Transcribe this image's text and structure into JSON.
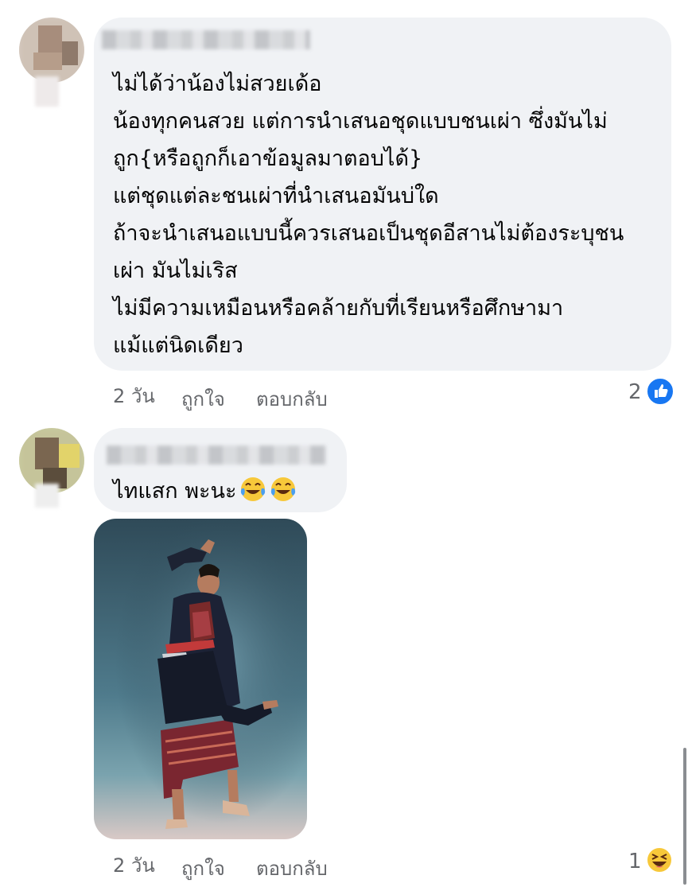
{
  "comments": [
    {
      "lines": [
        "ไม่ได้ว่าน้องไม่สวยเด้อ",
        "น้องทุกคนสวย แต่การนำเสนอชุดแบบชนเผ่า ซึ่งมันไม่",
        "ถูก{หรือถูกก็เอาข้อมูลมาตอบได้}",
        "แต่ชุดแต่ละชนเผ่าที่นำเสนอมันบ่ใด",
        "ถ้าจะนำเสนอแบบนี้ควรเสนอเป็นชุดอีสานไม่ต้องระบุชน",
        "เผ่า มันไม่เริส",
        "ไม่มีความเหมือนหรือคล้ายกับที่เรียนหรือศึกษามา",
        "แม้แต่นิดเดียว"
      ],
      "time": "2 วัน",
      "like_label": "ถูกใจ",
      "reply_label": "ตอบกลับ",
      "reaction_count": "2",
      "reaction_icon": "like-icon"
    },
    {
      "text": "ไทแสก พะนะ",
      "emoji": "face-with-tears-of-joy x2",
      "time": "2 วัน",
      "like_label": "ถูกใจ",
      "reply_label": "ตอบกลับ",
      "reaction_count": "1",
      "reaction_icon": "haha-icon"
    }
  ],
  "colors": {
    "bubble": "#f0f2f5",
    "meta_text": "#65676b",
    "like_blue": "#1877f2",
    "haha_yellow": "#f7c83a"
  }
}
